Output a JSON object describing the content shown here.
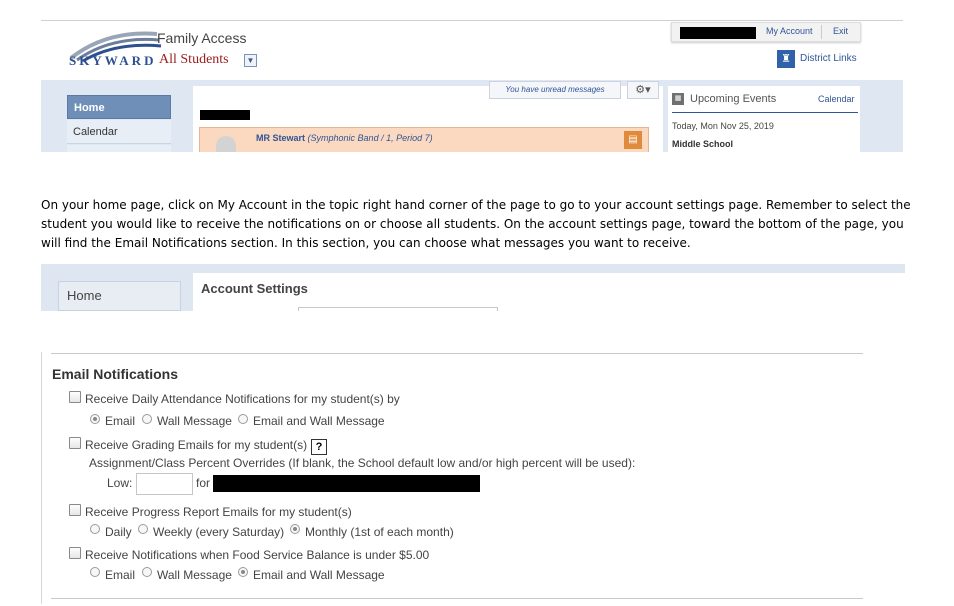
{
  "header": {
    "logo_text": "SKYWARD",
    "app_title": "Family Access",
    "student_selector": "All Students",
    "account_links": {
      "my_account": "My Account",
      "exit": "Exit"
    },
    "district_links": "District Links"
  },
  "sidebar": {
    "items": [
      {
        "label": "Home",
        "active": true
      },
      {
        "label": "Calendar"
      }
    ]
  },
  "main": {
    "unread_messages": "You have unread messages",
    "message": {
      "teacher": "MR Stewart",
      "class": "(Symphonic Band / 1, Period 7)"
    }
  },
  "events": {
    "title": "Upcoming Events",
    "calendar_link": "Calendar",
    "date": "Today, Mon Nov 25, 2019",
    "school": "Middle School"
  },
  "instructions": "On your home page, click on My Account in the topic right hand corner of the page to go to your account settings page.   Remember to select the student you would like to receive the notifications on or choose all students. On the account settings page, toward the bottom of the page, you will find the Email Notifications section.   In this section, you can choose what messages you want to receive.",
  "account_settings": {
    "nav_home": "Home",
    "title": "Account Settings"
  },
  "email_notifications": {
    "title": "Email Notifications",
    "attendance": {
      "label": "Receive Daily Attendance Notifications for my student(s) by",
      "options": [
        "Email",
        "Wall Message",
        "Email and Wall Message"
      ],
      "selected": "Email"
    },
    "grading": {
      "label": "Receive Grading Emails for my student(s)",
      "help": "?",
      "overrides_label": "Assignment/Class Percent Overrides (If blank, the School default low and/or high percent will be used):",
      "low_label": "Low:",
      "for_label": "for"
    },
    "progress": {
      "label": "Receive Progress Report Emails for my student(s)",
      "options": [
        "Daily",
        "Weekly (every Saturday)",
        "Monthly (1st of each month)"
      ],
      "selected": "Monthly (1st of each month)"
    },
    "food": {
      "label": "Receive Notifications when Food Service Balance is under $5.00",
      "options": [
        "Email",
        "Wall Message",
        "Email and Wall Message"
      ],
      "selected": "Email and Wall Message"
    }
  }
}
